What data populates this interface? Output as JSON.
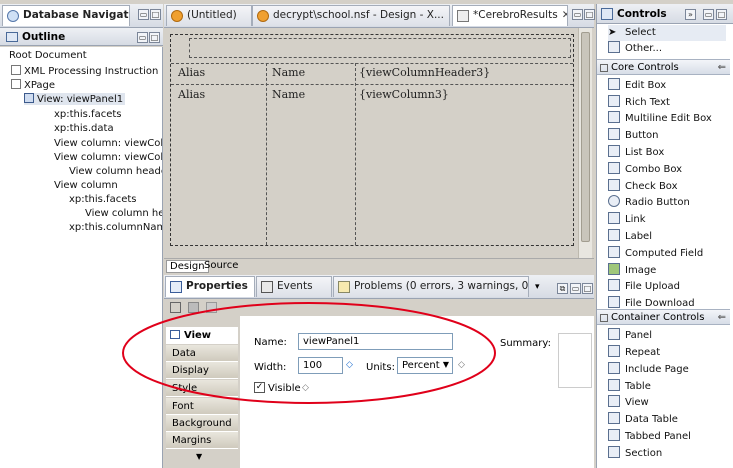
{
  "left_panel": {
    "tab_database_navigator": "Database Navigator",
    "outline_title": "Outline",
    "tree": [
      "Root Document",
      "XML Processing Instruction",
      "XPage",
      "View: viewPanel1",
      "xp:this.facets",
      "xp:this.data",
      "View column: viewColum",
      "View column: viewColum",
      "View column header:",
      "View column",
      "xp:this.facets",
      "View column head",
      "xp:this.columnName"
    ]
  },
  "editor": {
    "tabs": [
      "(Untitled)",
      "decrypt\\school.nsf - Design - X...",
      "*CerebroResults"
    ],
    "view_rows": [
      {
        "c1": "Alias",
        "c2": "Name",
        "c3": "{viewColumnHeader3}"
      },
      {
        "c1": "Alias",
        "c2": "Name",
        "c3": "{viewColumn3}"
      }
    ],
    "bottom_tabs": [
      "Design",
      "Source"
    ]
  },
  "bottom_panel": {
    "tabs": [
      "Properties",
      "Events",
      "Problems (0 errors, 3 warnings, 0 o..."
    ],
    "vertical_tabs": [
      "View",
      "Data",
      "Display",
      "Style",
      "Font",
      "Background",
      "Margins"
    ],
    "name_label": "Name:",
    "name_value": "viewPanel1",
    "width_label": "Width:",
    "width_value": "100",
    "units_label": "Units:",
    "units_value": "Percent",
    "visible_label": "Visible",
    "summary_label": "Summary:",
    "colors": {
      "highlight_ellipse": "#e0001a"
    }
  },
  "right_panel": {
    "title": "Controls",
    "top_items": [
      "Select",
      "Other..."
    ],
    "core_title": "Core Controls",
    "core_items": [
      "Edit Box",
      "Rich Text",
      "Multiline Edit Box",
      "Button",
      "List Box",
      "Combo Box",
      "Check Box",
      "Radio Button",
      "Link",
      "Label",
      "Computed Field",
      "Image",
      "File Upload",
      "File Download"
    ],
    "container_title": "Container Controls",
    "container_items": [
      "Panel",
      "Repeat",
      "Include Page",
      "Table",
      "View",
      "Data Table",
      "Tabbed Panel",
      "Section"
    ]
  }
}
